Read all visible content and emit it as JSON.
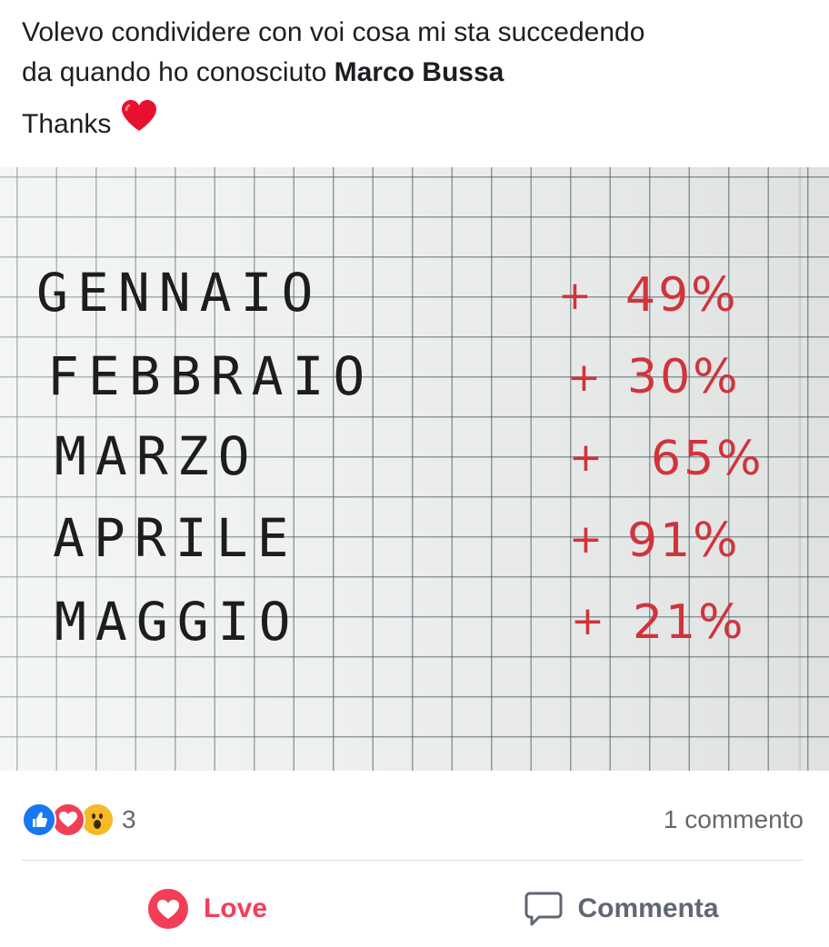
{
  "post": {
    "text_line1": "Volevo condividere con voi cosa mi sta succedendo",
    "text_line2_prefix": "da quando ho conosciuto ",
    "mention": "Marco Bussa",
    "thanks": "Thanks"
  },
  "photo": {
    "rows": [
      {
        "month": "GENNAIO",
        "plus": "+",
        "percent": "49%"
      },
      {
        "month": "FEBBRAIO",
        "plus": "+",
        "percent": "30%"
      },
      {
        "month": "MARZO",
        "plus": "+",
        "percent": "65%"
      },
      {
        "month": "APRILE",
        "plus": "+",
        "percent": "91%"
      },
      {
        "month": "MAGGIO",
        "plus": "+",
        "percent": "21%"
      }
    ]
  },
  "reactions": {
    "icons": [
      "like-icon",
      "love-icon",
      "wow-icon"
    ],
    "count": "3",
    "comments": "1 commento"
  },
  "actions": {
    "love_label": "Love",
    "comment_label": "Commenta"
  },
  "colors": {
    "like": "#1877f2",
    "love": "#f33e58",
    "wow": "#f7b928",
    "ink_red": "#d0343a",
    "muted": "#65676b"
  }
}
